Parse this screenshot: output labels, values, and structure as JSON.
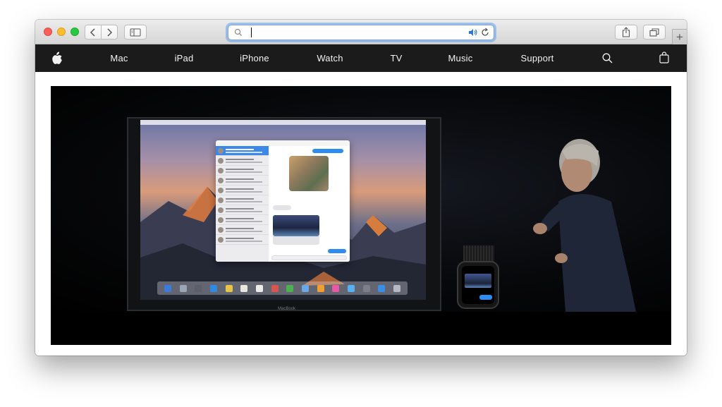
{
  "browser": {
    "address_bar": {
      "value": "",
      "placeholder": ""
    },
    "buttons": {
      "back": "back",
      "forward": "forward",
      "sidebar": "sidebar",
      "share": "share",
      "tabs": "tab-overview",
      "new_tab": "+"
    },
    "icons": [
      "search-icon",
      "speaker-icon",
      "reload-icon",
      "share-icon",
      "tabs-icon",
      "sidebar-icon",
      "chevron-left-icon",
      "chevron-right-icon"
    ]
  },
  "globalnav": {
    "logo": "apple-logo-icon",
    "items": [
      {
        "label": "Mac"
      },
      {
        "label": "iPad"
      },
      {
        "label": "iPhone"
      },
      {
        "label": "Watch"
      },
      {
        "label": "TV"
      },
      {
        "label": "Music"
      },
      {
        "label": "Support"
      }
    ],
    "search_icon": "search-icon",
    "bag_icon": "shopping-bag-icon"
  },
  "video": {
    "laptop_label": "MacBook"
  },
  "colors": {
    "nav_bg": "#1b1b1b",
    "nav_text": "#f2f2f2",
    "focus_ring": "#669ee8",
    "accent_blue": "#2d8cf0",
    "traffic_close": "#fc5f57",
    "traffic_min": "#fdbc2e",
    "traffic_max": "#28c840"
  }
}
